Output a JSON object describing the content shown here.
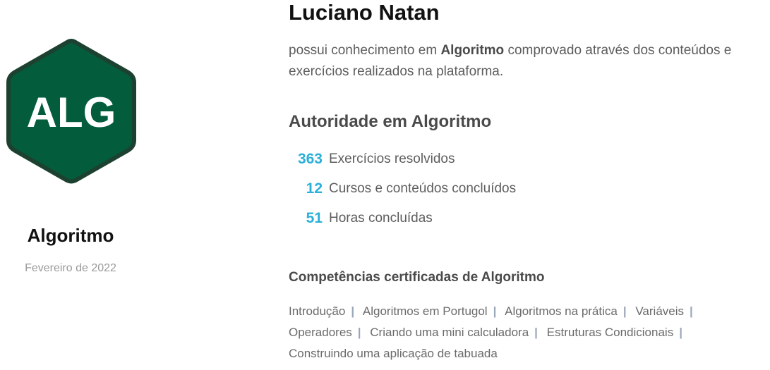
{
  "badge": {
    "abbreviation": "ALG",
    "fill_color": "#035c3c",
    "border_color": "#1d4130"
  },
  "subject": "Algoritmo",
  "date": "Fevereiro de 2022",
  "person_name": "Luciano Natan",
  "description": {
    "prefix": "possui conhecimento em ",
    "subject": "Algoritmo",
    "suffix": " comprovado através dos conteúdos e exercícios realizados na plataforma."
  },
  "authority": {
    "title": "Autoridade em Algoritmo",
    "stats": [
      {
        "value": "363",
        "label": "Exercícios resolvidos"
      },
      {
        "value": "12",
        "label": "Cursos e conteúdos concluídos"
      },
      {
        "value": "51",
        "label": "Horas concluídas"
      }
    ]
  },
  "competencies": {
    "title": "Competências certificadas de Algoritmo",
    "items": [
      "Introdução",
      "Algoritmos em Portugol",
      "Algoritmos na prática",
      "Variáveis",
      "Operadores",
      "Criando uma mini calculadora",
      "Estruturas Condicionais",
      "Construindo uma aplicação de tabuada"
    ],
    "separator": "|"
  },
  "colors": {
    "accent": "#2ab0d9",
    "badge_green": "#035c3c"
  }
}
